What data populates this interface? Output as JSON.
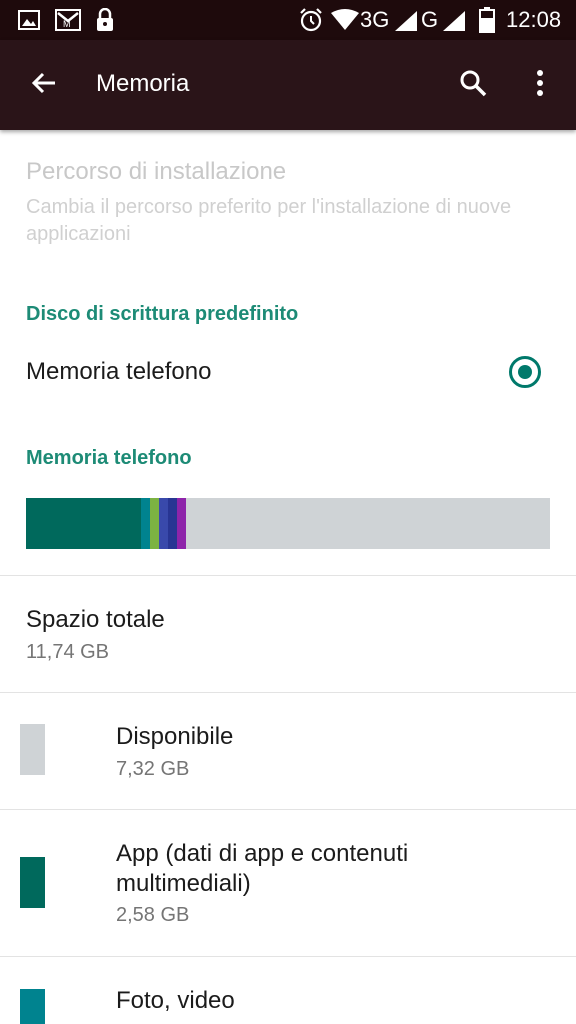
{
  "status_bar": {
    "network_1": "3G",
    "network_2": "G",
    "time": "12:08",
    "icons": [
      "gallery-icon",
      "mail-icon",
      "lock-icon",
      "alarm-icon",
      "wifi-icon",
      "signal-icon",
      "signal-icon",
      "battery-icon"
    ]
  },
  "toolbar": {
    "title": "Memoria",
    "back_icon": "back-arrow-icon",
    "search_icon": "search-icon",
    "more_icon": "more-vert-icon"
  },
  "install_path": {
    "title": "Percorso di installazione",
    "summary": "Cambia il percorso preferito per l'installazione di nuove applicazioni",
    "enabled": false
  },
  "default_disk": {
    "header": "Disco di scrittura predefinito",
    "option_label": "Memoria telefono",
    "selected": true
  },
  "phone_storage": {
    "header": "Memoria telefono",
    "bar_colors": {
      "available": "#cfd3d6",
      "apps": "#00695c",
      "photos": "#00838f",
      "audio": "#7cb342",
      "downloads": "#3949ab",
      "cache": "#283593",
      "misc": "#8e24aa"
    },
    "bar_fractions": {
      "apps": 0.22,
      "photos": 0.017,
      "audio": 0.017,
      "downloads": 0.017,
      "cache": 0.017,
      "misc": 0.017
    },
    "total": {
      "title": "Spazio totale",
      "value": "11,74 GB"
    },
    "items": [
      {
        "title": "Disponibile",
        "value": "7,32 GB",
        "color": "#cfd3d6"
      },
      {
        "title": "App (dati di app e contenuti multimediali)",
        "value": "2,58 GB",
        "color": "#00695c"
      },
      {
        "title": "Foto, video",
        "value": "",
        "color": "#00838f"
      }
    ]
  }
}
